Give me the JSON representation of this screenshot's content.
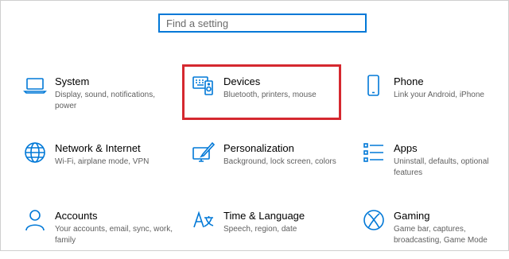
{
  "search": {
    "placeholder": "Find a setting"
  },
  "colors": {
    "accent": "#0078d7",
    "highlight": "#d5282f"
  },
  "tiles": [
    {
      "title": "System",
      "description": "Display, sound, notifications, power",
      "icon": "laptop-icon"
    },
    {
      "title": "Devices",
      "description": "Bluetooth, printers, mouse",
      "icon": "keyboard-speaker-icon"
    },
    {
      "title": "Phone",
      "description": "Link your Android, iPhone",
      "icon": "phone-icon"
    },
    {
      "title": "Network & Internet",
      "description": "Wi-Fi, airplane mode, VPN",
      "icon": "globe-icon"
    },
    {
      "title": "Personalization",
      "description": "Background, lock screen, colors",
      "icon": "paint-brush-icon"
    },
    {
      "title": "Apps",
      "description": "Uninstall, defaults, optional features",
      "icon": "apps-list-icon"
    },
    {
      "title": "Accounts",
      "description": "Your accounts, email, sync, work, family",
      "icon": "person-icon"
    },
    {
      "title": "Time & Language",
      "description": "Speech, region, date",
      "icon": "language-icon"
    },
    {
      "title": "Gaming",
      "description": "Game bar, captures, broadcasting, Game Mode",
      "icon": "xbox-icon"
    }
  ]
}
